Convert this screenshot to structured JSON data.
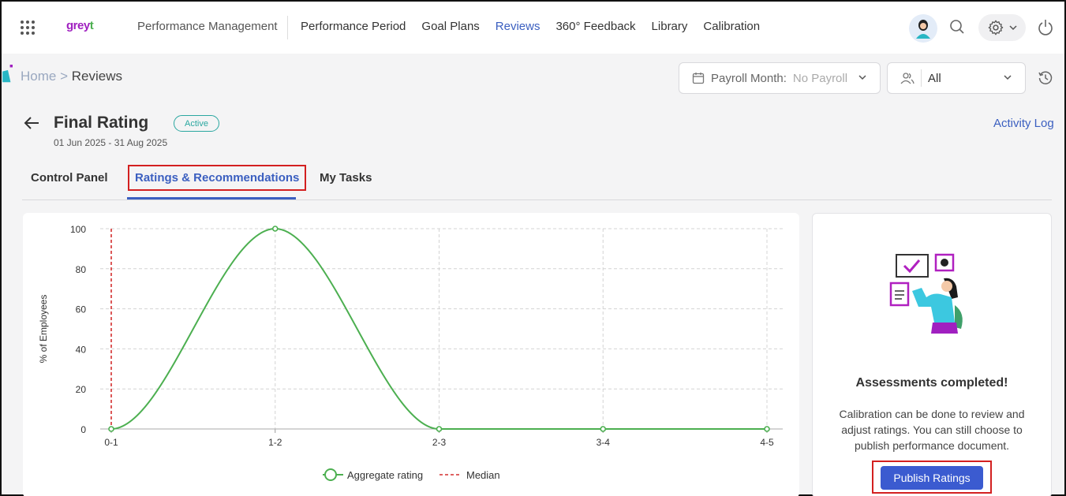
{
  "app": {
    "logo_main": "grey",
    "logo_accent": "t",
    "brand_label": "Performance Management"
  },
  "nav": {
    "items": [
      {
        "label": "Performance Period",
        "active": false
      },
      {
        "label": "Goal Plans",
        "active": false
      },
      {
        "label": "Reviews",
        "active": true
      },
      {
        "label": "360° Feedback",
        "active": false
      },
      {
        "label": "Library",
        "active": false
      },
      {
        "label": "Calibration",
        "active": false
      }
    ]
  },
  "breadcrumb": {
    "home": "Home",
    "sep": ">",
    "current": "Reviews"
  },
  "filters": {
    "payroll_label": "Payroll Month:",
    "payroll_value": "No Payroll",
    "group_value": "All"
  },
  "header": {
    "title": "Final Rating",
    "status": "Active",
    "dates": "01 Jun 2025 - 31 Aug 2025",
    "activity_log": "Activity Log"
  },
  "tabs": [
    {
      "label": "Control Panel",
      "active": false
    },
    {
      "label": "Ratings & Recommendations",
      "active": true
    },
    {
      "label": "My Tasks",
      "active": false
    }
  ],
  "colors": {
    "accent": "#3b5fc0",
    "line": "#4caf50",
    "median": "#d32f2f",
    "highlight_border": "#d32020"
  },
  "chart_data": {
    "type": "line",
    "categories": [
      "0-1",
      "1-2",
      "2-3",
      "3-4",
      "4-5"
    ],
    "series": [
      {
        "name": "Aggregate rating",
        "values": [
          0,
          100,
          0,
          0,
          0
        ]
      }
    ],
    "median": {
      "name": "Median",
      "category": "0-1"
    },
    "ylabel": "% of Employees",
    "yticks": [
      0,
      20,
      40,
      60,
      80,
      100
    ],
    "ylim": [
      0,
      100
    ],
    "grid": true,
    "legend": "bottom-center"
  },
  "side": {
    "title": "Assessments completed!",
    "text": "Calibration can be done to review and adjust ratings. You can still choose to publish performance document.",
    "button": "Publish Ratings"
  }
}
